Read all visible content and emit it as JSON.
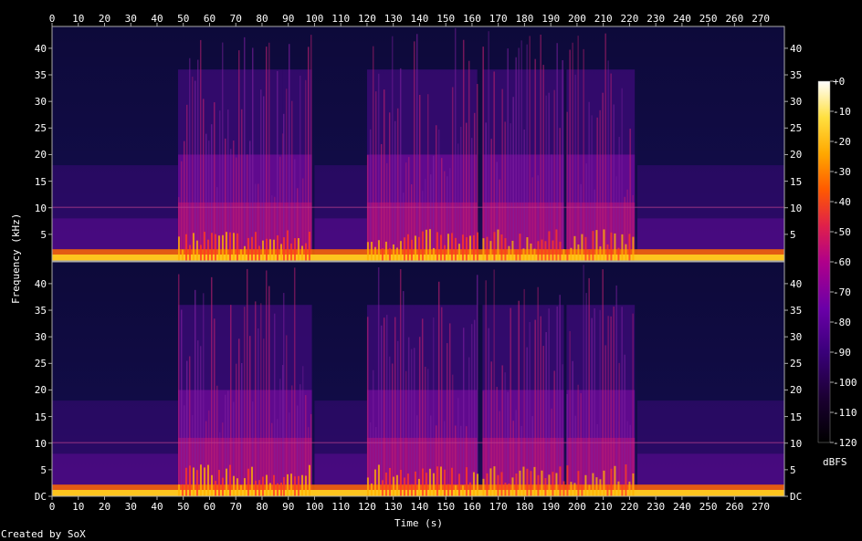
{
  "chart_data": {
    "type": "heatmap",
    "description_kind": "spectrogram",
    "channels": 2,
    "x_axis": {
      "label": "Time (s)",
      "range": [
        0,
        279
      ],
      "ticks": [
        0,
        10,
        20,
        30,
        40,
        50,
        60,
        70,
        80,
        90,
        100,
        110,
        120,
        130,
        140,
        150,
        160,
        170,
        180,
        190,
        200,
        210,
        220,
        230,
        240,
        250,
        260,
        270
      ]
    },
    "y_axis": {
      "label": "Frequency (kHz)",
      "range": [
        0,
        44.1
      ],
      "ticks_top": [
        "5",
        "10",
        "15",
        "20",
        "25",
        "30",
        "35",
        "40"
      ],
      "ticks_bottom": [
        "DC",
        "5",
        "10",
        "15",
        "20",
        "25",
        "30",
        "35",
        "40"
      ]
    },
    "colorbar": {
      "unit": "dBFS",
      "range": [
        -120,
        0
      ],
      "ticks": [
        "+0",
        "-10",
        "-20",
        "-30",
        "-40",
        "-50",
        "-60",
        "-70",
        "-80",
        "-90",
        "-100",
        "-110",
        "-120"
      ],
      "colormap": [
        "#000000",
        "#1a0030",
        "#3a007a",
        "#6a00a8",
        "#b0008a",
        "#e0204a",
        "#ff5a00",
        "#ffa800",
        "#ffe040",
        "#ffffff"
      ]
    },
    "loud_segments_s": [
      [
        48,
        88
      ],
      [
        88,
        99
      ],
      [
        120,
        162
      ],
      [
        164,
        195
      ],
      [
        196,
        222
      ]
    ],
    "quiet_segments_s": [
      [
        0,
        48
      ],
      [
        100,
        120
      ],
      [
        223,
        279
      ]
    ]
  },
  "footer": {
    "credit": "Created by SoX"
  }
}
